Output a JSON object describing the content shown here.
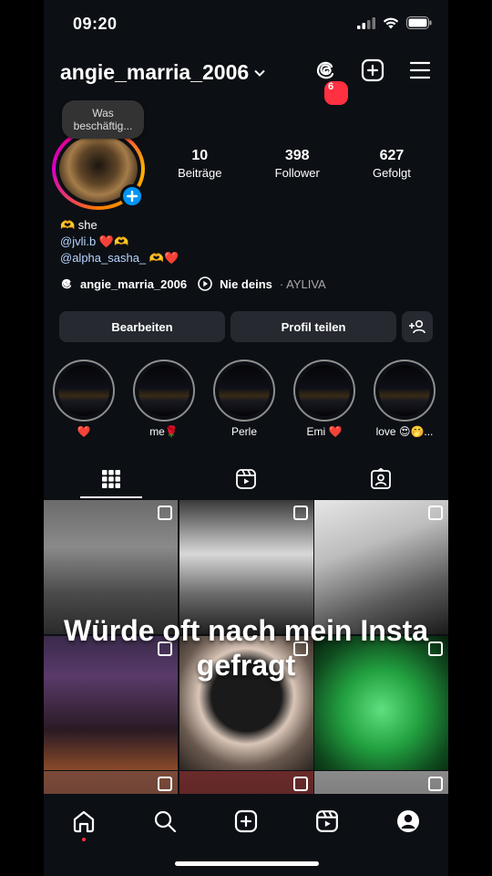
{
  "status": {
    "time": "09:20"
  },
  "header": {
    "username": "angie_marria_2006",
    "threads_badge": "6"
  },
  "note": {
    "text": "Was beschäftig..."
  },
  "stats": [
    {
      "value": "10",
      "label": "Beiträge"
    },
    {
      "value": "398",
      "label": "Follower"
    },
    {
      "value": "627",
      "label": "Gefolgt"
    }
  ],
  "bio": {
    "line1": "🫶 she",
    "line2": "@jvli.b ❤️🫶",
    "line3": "@alpha_sasha_ 🫶❤️"
  },
  "links": {
    "threads_handle": "angie_marria_2006",
    "song": "Nie deins",
    "artist": "· AYLIVA"
  },
  "buttons": {
    "edit": "Bearbeiten",
    "share": "Profil teilen"
  },
  "highlights": [
    {
      "label": "❤️"
    },
    {
      "label": "me🌹"
    },
    {
      "label": "Perle"
    },
    {
      "label": "Emi ❤️"
    },
    {
      "label": "love 😍🤭..."
    }
  ],
  "overlay": {
    "line1": "Würde oft nach mein Insta",
    "line2": "gefragt"
  },
  "icons": {
    "threads": "threads-icon",
    "new_post": "plus-square-icon",
    "menu": "hamburger-icon",
    "add_person": "add-person-icon",
    "grid": "grid-icon",
    "reels": "reels-icon",
    "tagged": "tagged-icon"
  },
  "colors": {
    "accent": "#0095f6",
    "badge": "#ff3040",
    "background": "#0c0f14",
    "button": "#262a30"
  }
}
